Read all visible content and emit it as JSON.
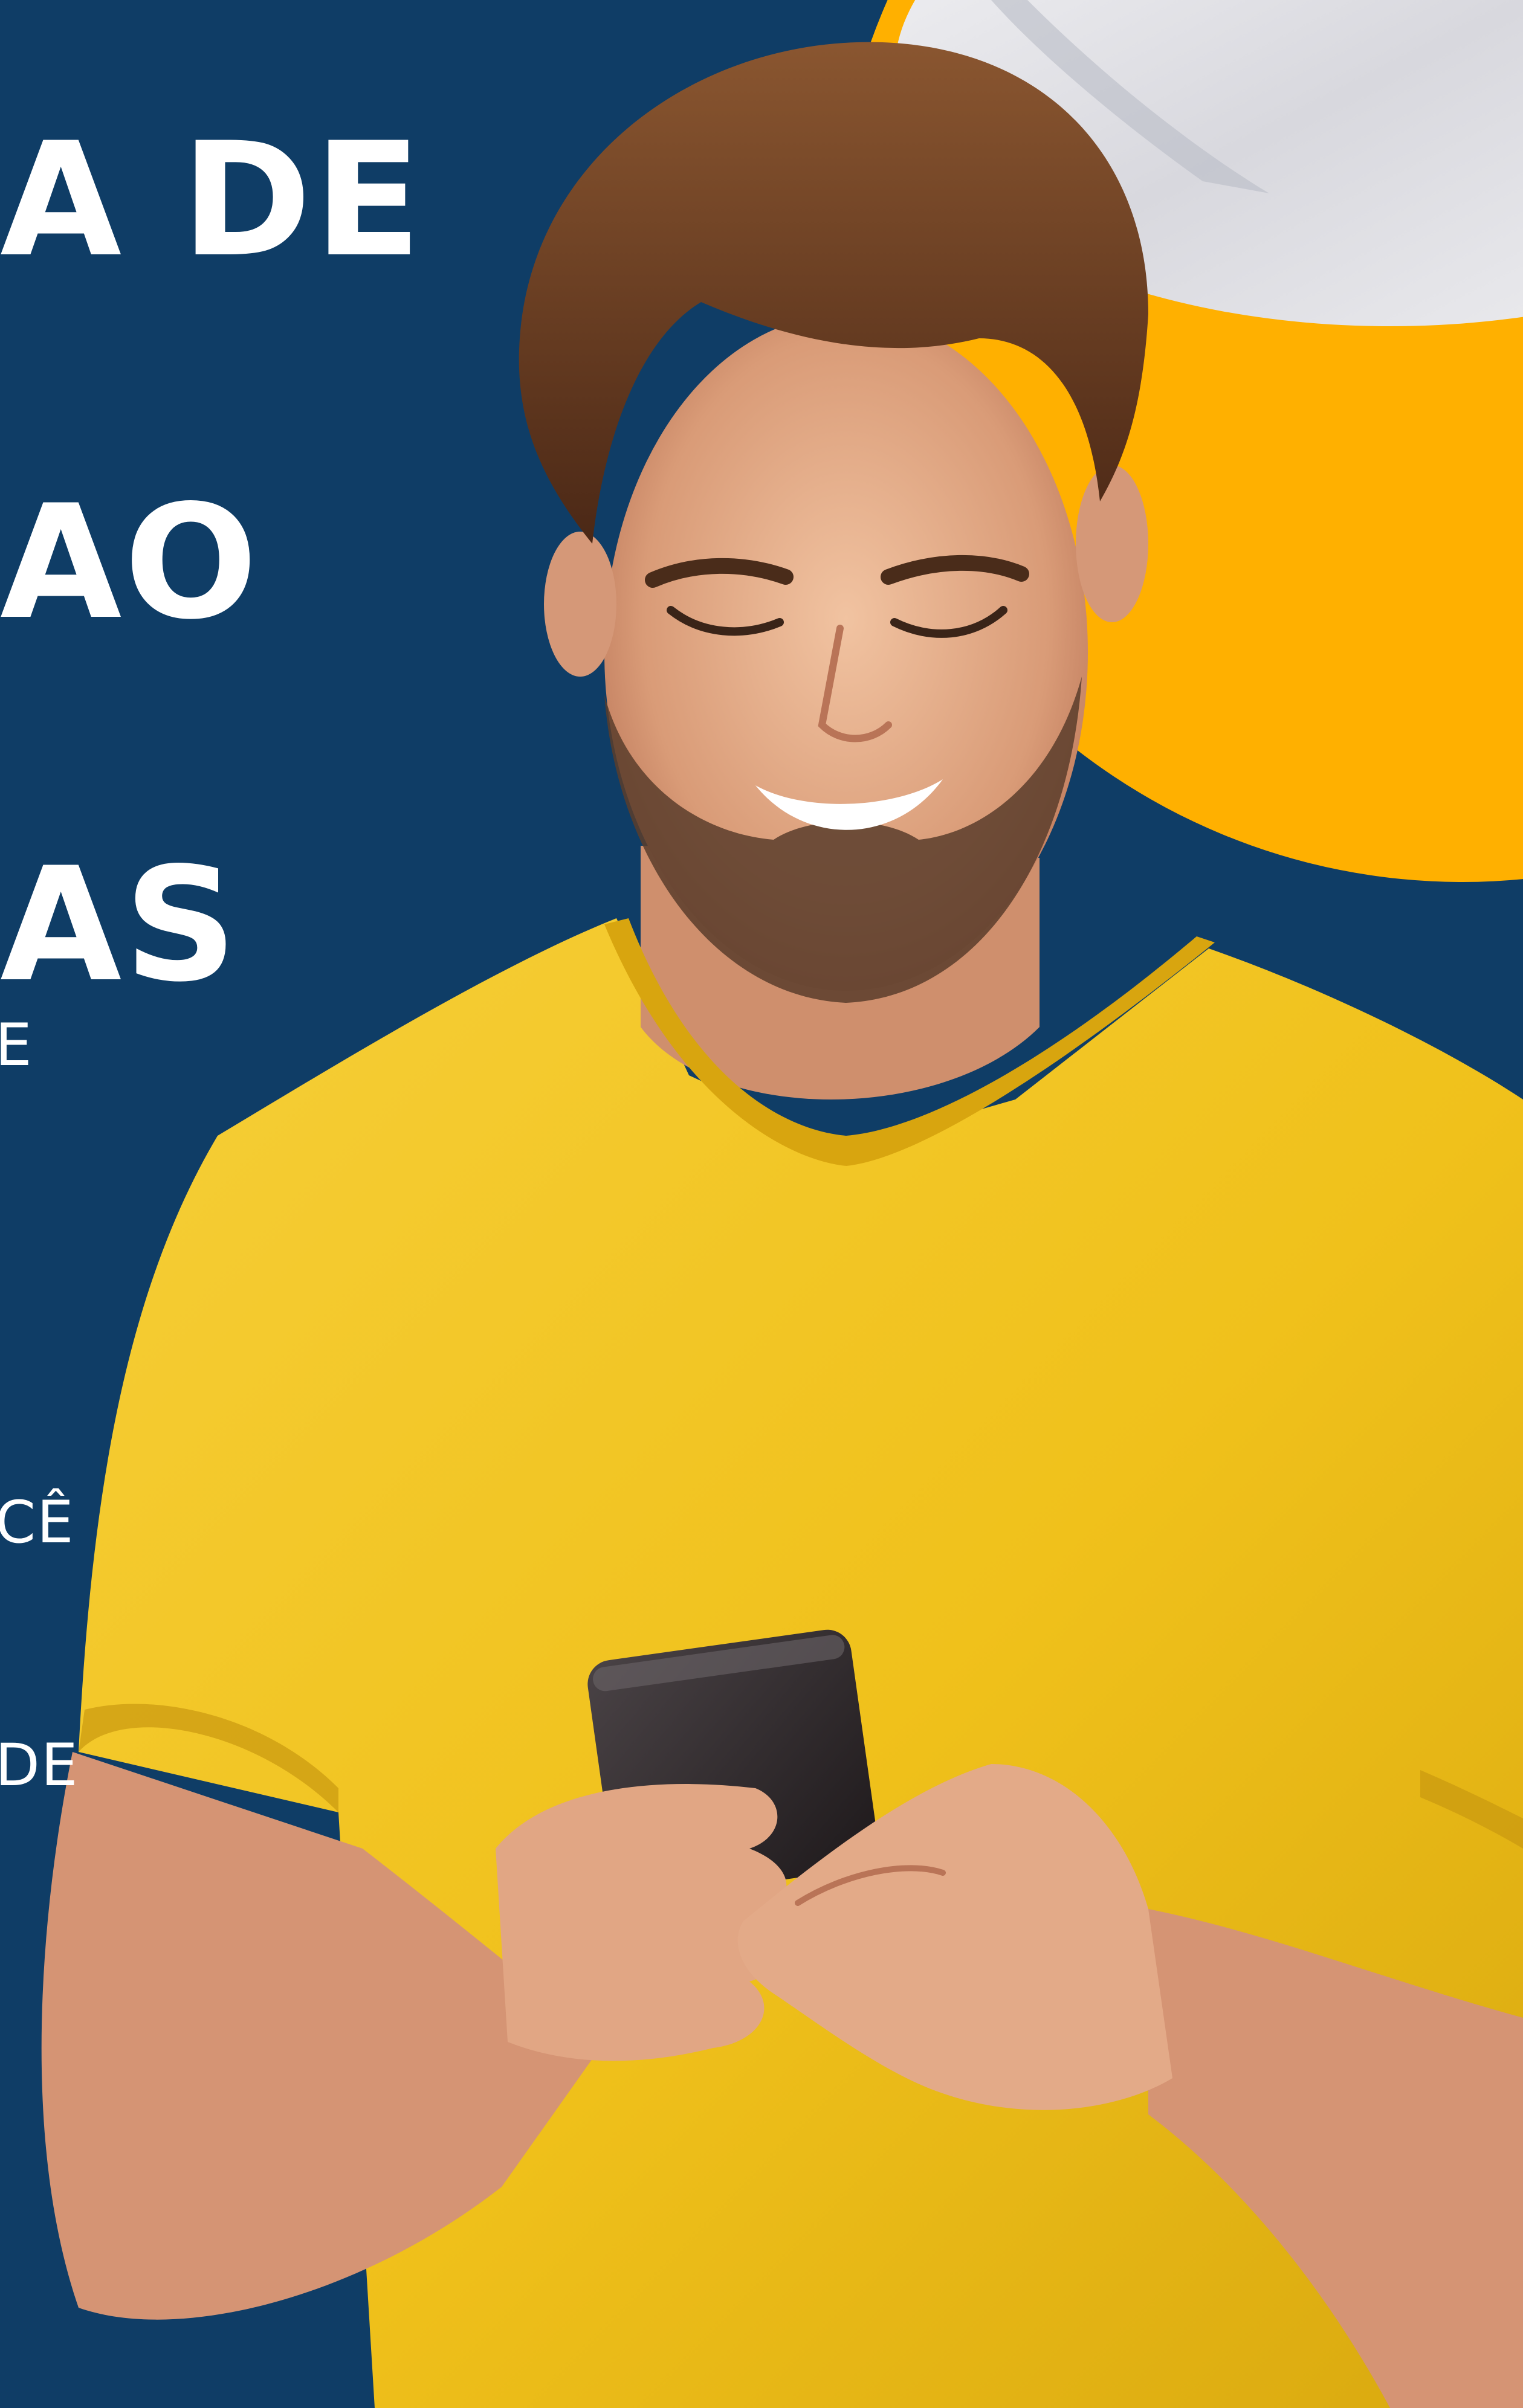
{
  "headline": {
    "lines": [
      "A DE",
      "AO",
      "AS"
    ]
  },
  "body_copy": {
    "lines": [
      "E",
      "",
      "CÊ",
      "DE"
    ]
  },
  "colors": {
    "background": "#0f3d66",
    "accent_orange": "#ffb000",
    "shirt_yellow": "#f2c21c",
    "skin": "#e7ae8a",
    "hair": "#6a3d22",
    "phone": "#2b2528",
    "white_photo": "#e9e9ec"
  },
  "icons": {
    "decorative_circle": "orange-circle-graphic",
    "person": "smiling-man-with-phone-photo"
  }
}
